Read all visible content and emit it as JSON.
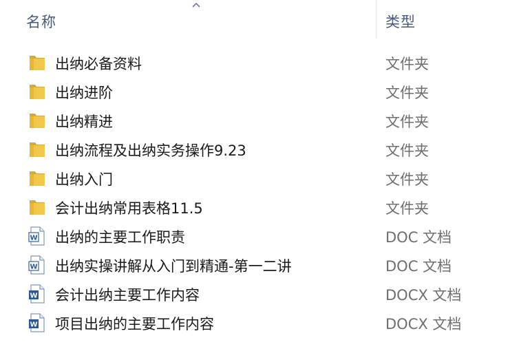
{
  "header": {
    "name_label": "名称",
    "type_label": "类型",
    "sort_icon": "sort-ascending-icon"
  },
  "files": [
    {
      "name": "出纳必备资料",
      "type": "文件夹",
      "icon": "folder-icon"
    },
    {
      "name": "出纳进阶",
      "type": "文件夹",
      "icon": "folder-icon"
    },
    {
      "name": "出纳精进",
      "type": "文件夹",
      "icon": "folder-icon"
    },
    {
      "name": "出纳流程及出纳实务操作9.23",
      "type": "文件夹",
      "icon": "folder-icon"
    },
    {
      "name": "出纳入门",
      "type": "文件夹",
      "icon": "folder-icon"
    },
    {
      "name": "会计出纳常用表格11.5",
      "type": "文件夹",
      "icon": "folder-icon"
    },
    {
      "name": "出纳的主要工作职责",
      "type": "DOC 文档",
      "icon": "word-doc-icon"
    },
    {
      "name": "出纳实操讲解从入门到精通-第一二讲",
      "type": "DOC 文档",
      "icon": "word-doc-icon"
    },
    {
      "name": "会计出纳主要工作内容",
      "type": "DOCX 文档",
      "icon": "word-docx-icon"
    },
    {
      "name": "项目出纳的主要工作内容",
      "type": "DOCX 文档",
      "icon": "word-docx-icon"
    }
  ],
  "colors": {
    "header_text": "#4a5a7a",
    "folder_yellow": "#f2c84b",
    "word_blue": "#2b5797"
  }
}
